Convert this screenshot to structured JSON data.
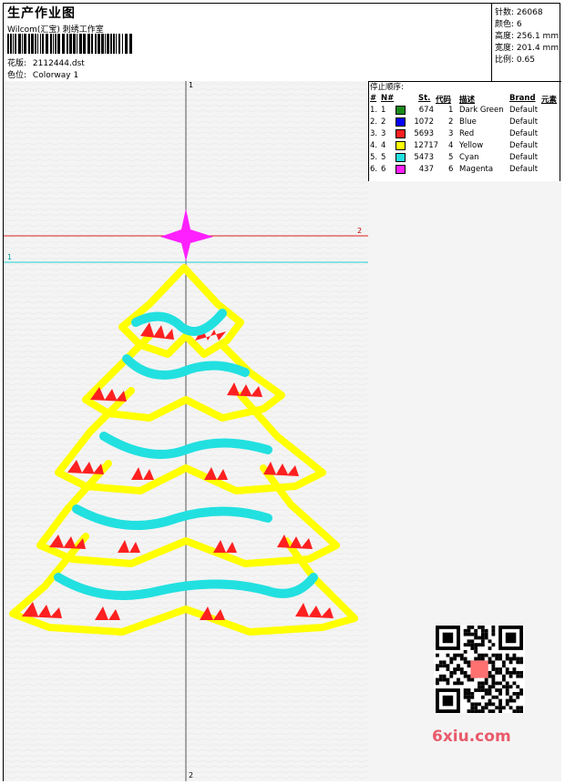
{
  "header": {
    "title": "生产作业图",
    "company": "Wilcom(汇宝) 刺绣工作室",
    "design_label": "花版:",
    "design_value": "2112444.dst",
    "colorway_label": "色位:",
    "colorway_value": "Colorway 1"
  },
  "stats": {
    "stitches_label": "针数:",
    "stitches": "26068",
    "colors_label": "颜色:",
    "colors": "6",
    "height_label": "高度:",
    "height": "256.1 mm",
    "width_label": "宽度:",
    "width": "201.4 mm",
    "scale_label": "比例:",
    "scale": "0.65"
  },
  "stop_sequence": {
    "title": "停止顺序:",
    "columns": {
      "num": "#",
      "n": "N#",
      "st": "St.",
      "code": "代码",
      "desc": "描述",
      "brand": "Brand",
      "elem": "元素"
    },
    "rows": [
      {
        "num": "1.",
        "n": "1",
        "color": "#1a8a1a",
        "st": "674",
        "code": "1",
        "desc": "Dark Green",
        "brand": "Default"
      },
      {
        "num": "2.",
        "n": "2",
        "color": "#0000ff",
        "st": "1072",
        "code": "2",
        "desc": "Blue",
        "brand": "Default"
      },
      {
        "num": "3.",
        "n": "3",
        "color": "#ff2020",
        "st": "5693",
        "code": "3",
        "desc": "Red",
        "brand": "Default"
      },
      {
        "num": "4.",
        "n": "4",
        "color": "#ffff00",
        "st": "12717",
        "code": "4",
        "desc": "Yellow",
        "brand": "Default"
      },
      {
        "num": "5.",
        "n": "5",
        "color": "#22e0e0",
        "st": "5473",
        "code": "5",
        "desc": "Cyan",
        "brand": "Default"
      },
      {
        "num": "6.",
        "n": "6",
        "color": "#ff20ff",
        "st": "437",
        "code": "6",
        "desc": "Magenta",
        "brand": "Default"
      }
    ]
  },
  "guides": {
    "top_marker": "1",
    "bottom_marker": "2",
    "red_line_marker": "2",
    "cyan_line_marker": "1"
  },
  "watermark": {
    "site": "6xiu.com"
  }
}
